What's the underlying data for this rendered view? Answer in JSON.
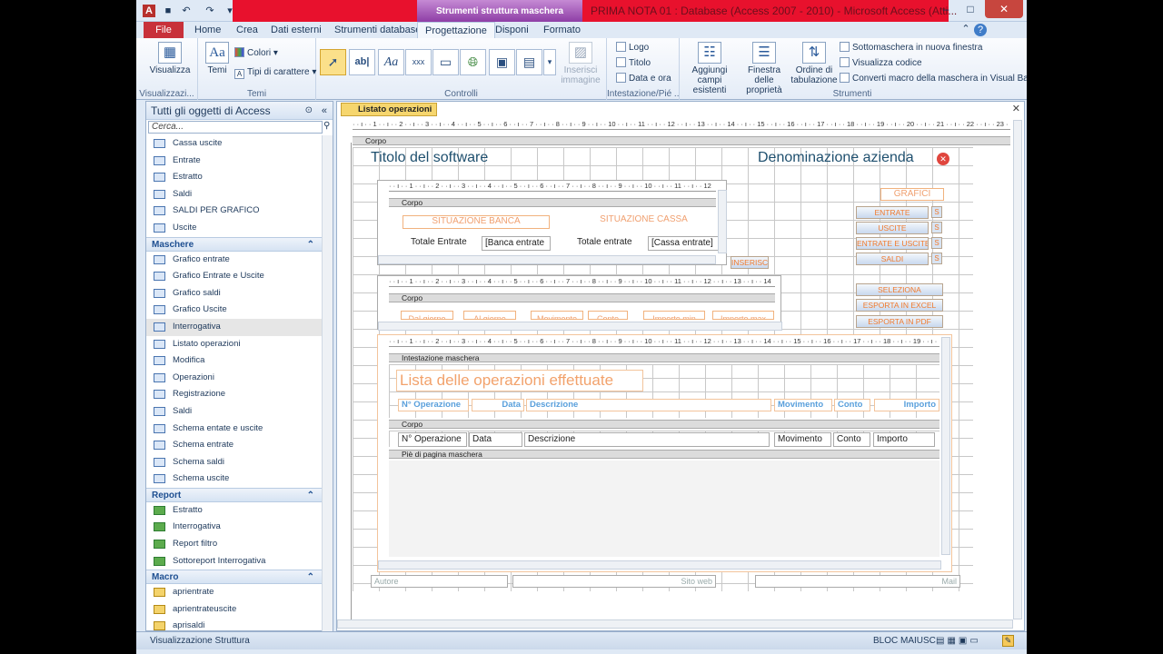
{
  "window": {
    "context_tab_title": "Strumenti struttura maschera",
    "title": "PRIMA NOTA 01 : Database (Access 2007 - 2010) - Microsoft Access (Atti..."
  },
  "tabs": [
    "File",
    "Home",
    "Crea",
    "Dati esterni",
    "Strumenti database",
    "Progettazione",
    "Disponi",
    "Formato"
  ],
  "ribbon": {
    "visualizza": "Visualizza",
    "temi": "Temi",
    "colori": "Colori",
    "tipi_carattere": "Tipi di carattere",
    "group_visualizzazioni": "Visualizzazi...",
    "group_temi": "Temi",
    "group_controlli": "Controlli",
    "inserisci_immagine": "Inserisci immagine",
    "logo": "Logo",
    "titolo": "Titolo",
    "data_ora": "Data e ora",
    "group_intestazione": "Intestazione/Pié ...",
    "aggiungi_campi": "Aggiungi campi esistenti",
    "finestra_proprieta": "Finestra delle proprietà",
    "ordine_tabulazione": "Ordine di tabulazione",
    "sottomaschera": "Sottomaschera in nuova finestra",
    "visualizza_codice": "Visualizza codice",
    "converti_macro": "Converti macro della maschera in Visual Basic",
    "group_strumenti": "Strumenti"
  },
  "nav": {
    "header": "Tutti gli oggetti di Access",
    "search_placeholder": "Cerca...",
    "tables": [
      "Cassa uscite",
      "Entrate",
      "Estratto",
      "Saldi",
      "SALDI PER GRAFICO",
      "Uscite"
    ],
    "section_maschere": "Maschere",
    "forms": [
      "Grafico entrate",
      "Grafico Entrate e Uscite",
      "Grafico saldi",
      "Grafico Uscite",
      "Interrogativa",
      "Listato operazioni",
      "Modifica",
      "Operazioni",
      "Registrazione",
      "Saldi",
      "Schema entate e uscite",
      "Schema entrate",
      "Schema saldi",
      "Schema uscite"
    ],
    "section_report": "Report",
    "reports": [
      "Estratto",
      "Interrogativa",
      "Report filtro",
      "Sottoreport Interrogativa"
    ],
    "section_macro": "Macro",
    "macros": [
      "aprientrate",
      "aprientrateuscite",
      "aprisaldi"
    ]
  },
  "doc": {
    "tab_label": "Listato operazioni",
    "section_corpo": "Corpo",
    "titolo_software": "Titolo del software",
    "denominazione": "Denominazione azienda",
    "situazione_banca": "SITUAZIONE BANCA",
    "situazione_cassa": "SITUAZIONE CASSA",
    "totale_entrate_1": "Totale Entrate",
    "banca_entrate": "[Banca entrate",
    "totale_entrate_2": "Totale entrate",
    "cassa_entrate": "[Cassa entrate]",
    "inserisci": "INSERISCI",
    "grafici": "GRAFICI",
    "btn_entrate": "ENTRATE",
    "btn_uscite": "USCITE",
    "btn_entrate_uscite": "ENTRATE E USCITE",
    "btn_saldi": "SALDI",
    "btn_s": "S",
    "seleziona": "SELEZIONA",
    "esporta_excel": "ESPORTA IN EXCEL",
    "esporta_pdf": "ESPORTA IN PDF",
    "filter_labels": [
      "Dal giorno",
      "Al giorno",
      "Movimento",
      "Conto",
      "Importo min",
      "Importo max"
    ],
    "intestazione_maschera": "Intestazione maschera",
    "lista_titolo": "Lista delle operazioni effettuate",
    "col_headers": [
      "N° Operazione",
      "Data",
      "Descrizione",
      "Movimento",
      "Conto",
      "Importo"
    ],
    "corpo_fields": [
      "N° Operazione",
      "Data",
      "Descrizione",
      "Movimento",
      "Conto",
      "Importo"
    ],
    "pie_pagina": "Piè di pagina maschera",
    "autore": "Autore",
    "sito_web": "Sito web",
    "mail": "Mail"
  },
  "status": {
    "left": "Visualizzazione Struttura",
    "caps": "BLOC MAIUSC"
  },
  "colors": {
    "file_tab": "#c8313a",
    "context_band": "#e8112d",
    "context_tab": "#9b4db3",
    "label_orange": "#f0a070",
    "label_blue": "#5aa0dc",
    "doc_tab": "#f6d66e"
  }
}
